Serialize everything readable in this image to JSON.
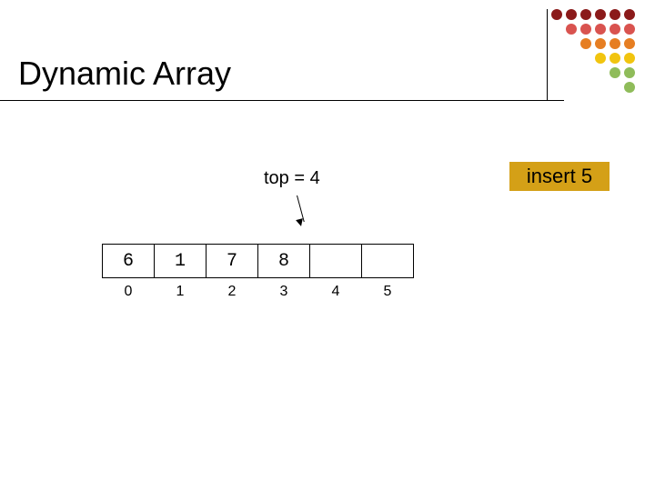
{
  "title": "Dynamic Array",
  "top_label": "top = 4",
  "insert_label": "insert 5",
  "array_cells": [
    "6",
    "1",
    "7",
    "8",
    "",
    ""
  ],
  "indices": [
    "0",
    "1",
    "2",
    "3",
    "4",
    "5"
  ],
  "dot_colors": {
    "dark_red": "#8b1a1a",
    "red": "#d9534f",
    "orange": "#e67e22",
    "yellow": "#f1c40f",
    "green": "#8fbc5a"
  },
  "dot_pattern": [
    [
      "dark_red",
      "dark_red",
      "dark_red",
      "dark_red",
      "dark_red",
      "dark_red"
    ],
    [
      "",
      "red",
      "red",
      "red",
      "red",
      "red"
    ],
    [
      "",
      "",
      "orange",
      "orange",
      "orange",
      "orange"
    ],
    [
      "",
      "",
      "",
      "yellow",
      "yellow",
      "yellow"
    ],
    [
      "",
      "",
      "",
      "",
      "green",
      "green"
    ],
    [
      "",
      "",
      "",
      "",
      "",
      "green"
    ]
  ]
}
